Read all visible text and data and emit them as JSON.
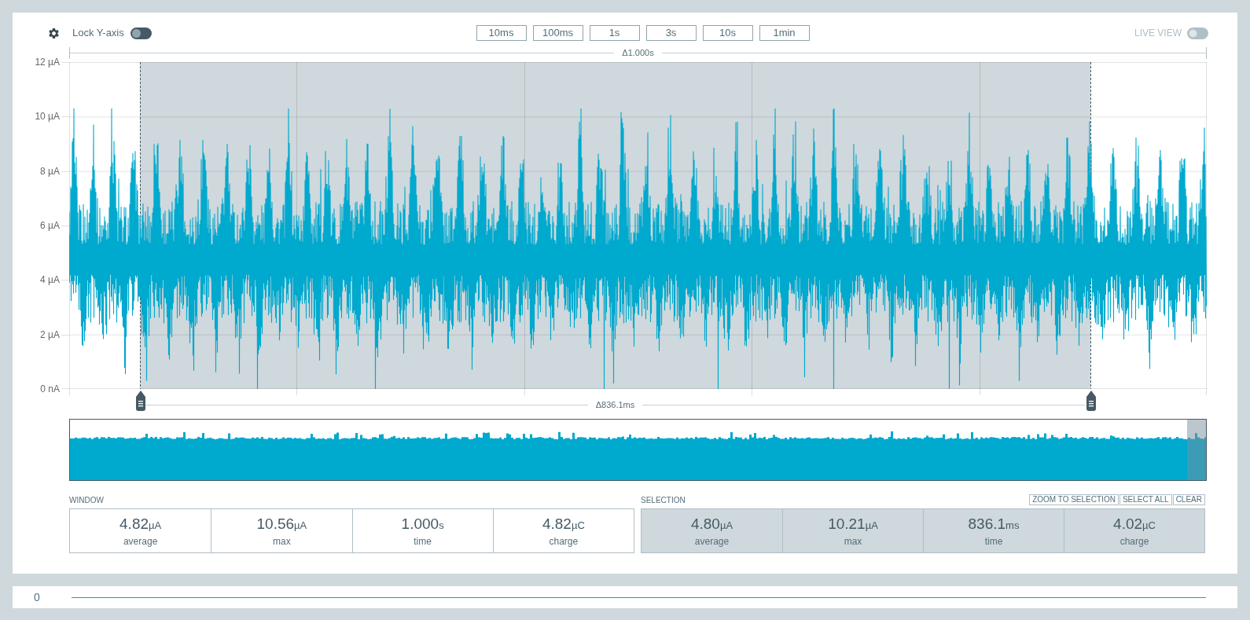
{
  "toolbar": {
    "lock_y_axis": {
      "label": "Lock Y-axis",
      "on": false
    },
    "time_buttons": [
      {
        "label": "10ms"
      },
      {
        "label": "100ms"
      },
      {
        "label": "1s"
      },
      {
        "label": "3s"
      },
      {
        "label": "10s"
      },
      {
        "label": "1min"
      }
    ],
    "live_view": {
      "label": "LIVE VIEW",
      "on": false,
      "disabled": true
    }
  },
  "chart": {
    "window_span": "Δ1.000s",
    "y_axis_labels": [
      "12 µA",
      "10 µA",
      "8 µA",
      "6 µA",
      "4 µA",
      "2 µA",
      "0 nA"
    ],
    "selection_span": "Δ836.1ms"
  },
  "window_stats": {
    "title": "WINDOW",
    "stats": [
      {
        "value": "4.82",
        "unit": "µA",
        "label": "average"
      },
      {
        "value": "10.56",
        "unit": "µA",
        "label": "max"
      },
      {
        "value": "1.000",
        "unit": "s",
        "label": "time"
      },
      {
        "value": "4.82",
        "unit": "µC",
        "label": "charge"
      }
    ]
  },
  "selection_stats": {
    "title": "SELECTION",
    "actions": [
      {
        "label": "ZOOM TO SELECTION"
      },
      {
        "label": "SELECT ALL"
      },
      {
        "label": "CLEAR"
      }
    ],
    "stats": [
      {
        "value": "4.80",
        "unit": "µA",
        "label": "average"
      },
      {
        "value": "10.21",
        "unit": "µA",
        "label": "max"
      },
      {
        "value": "836.1",
        "unit": "ms",
        "label": "time"
      },
      {
        "value": "4.02",
        "unit": "µC",
        "label": "charge"
      }
    ]
  },
  "bottom_panel": {
    "value": "0"
  }
}
